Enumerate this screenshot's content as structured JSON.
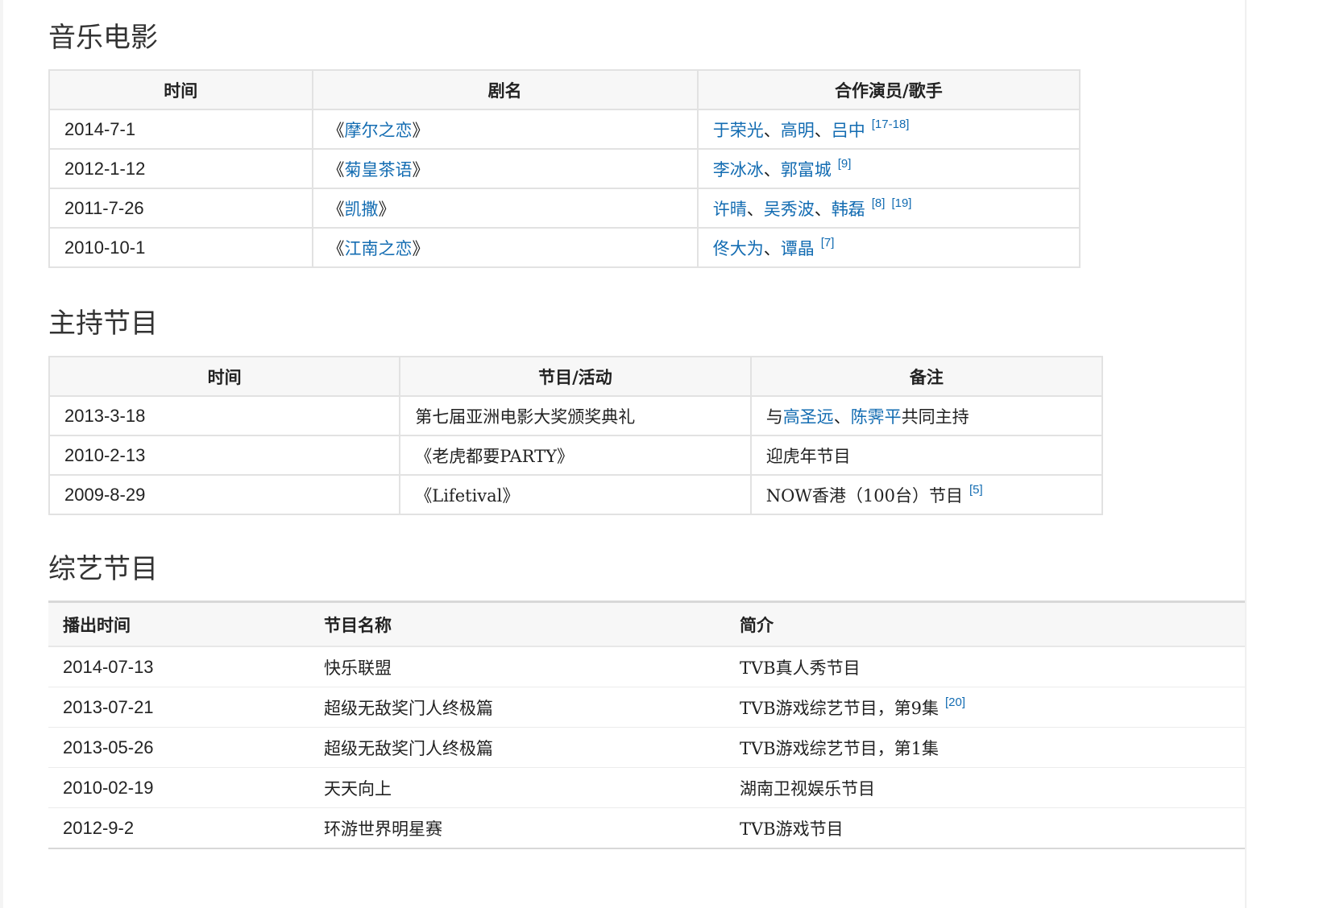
{
  "music_films": {
    "heading": "音乐电影",
    "columns": [
      "时间",
      "剧名",
      "合作演员/歌手"
    ],
    "rows": [
      {
        "date": "2014-7-1",
        "title_open": "《",
        "title": "摩尔之恋",
        "title_close": "》",
        "cast": [
          "于荣光",
          "高明",
          "吕中"
        ],
        "sep": "、",
        "refs": [
          "[17-18]"
        ]
      },
      {
        "date": "2012-1-12",
        "title_open": "《",
        "title": "菊皇茶语",
        "title_close": "》",
        "cast": [
          "李冰冰",
          "郭富城"
        ],
        "sep": "、",
        "refs": [
          "[9]"
        ]
      },
      {
        "date": "2011-7-26",
        "title_open": "《",
        "title": "凯撒",
        "title_close": "》",
        "cast": [
          "许晴",
          "吴秀波",
          "韩磊"
        ],
        "sep": "、",
        "refs": [
          "[8]",
          "[19]"
        ]
      },
      {
        "date": "2010-10-1",
        "title_open": "《",
        "title": "江南之恋",
        "title_close": "》",
        "cast": [
          "佟大为",
          "谭晶"
        ],
        "sep": "、",
        "refs": [
          "[7]"
        ]
      }
    ]
  },
  "hosting": {
    "heading": "主持节目",
    "columns": [
      "时间",
      "节目/活动",
      "备注"
    ],
    "rows": [
      {
        "date": "2013-3-18",
        "program": "第七届亚洲电影大奖颁奖典礼",
        "note_prefix": "与",
        "note_links": [
          "高圣远",
          "陈霁平"
        ],
        "note_sep": "、",
        "note_suffix": "共同主持",
        "refs": []
      },
      {
        "date": "2010-2-13",
        "program": "《老虎都要PARTY》",
        "note_prefix": "迎虎年节目",
        "note_links": [],
        "note_sep": "",
        "note_suffix": "",
        "refs": []
      },
      {
        "date": "2009-8-29",
        "program": "《Lifetival》",
        "note_prefix": "NOW香港（100台）节目",
        "note_links": [],
        "note_sep": "",
        "note_suffix": "",
        "refs": [
          "[5]"
        ]
      }
    ]
  },
  "variety": {
    "heading": "综艺节目",
    "columns": [
      "播出时间",
      "节目名称",
      "简介"
    ],
    "rows": [
      {
        "date": "2014-07-13",
        "name": "快乐联盟",
        "desc": "TVB真人秀节目",
        "refs": []
      },
      {
        "date": "2013-07-21",
        "name": "超级无敌奖门人终极篇",
        "desc": "TVB游戏综艺节目，第9集",
        "refs": [
          "[20]"
        ]
      },
      {
        "date": "2013-05-26",
        "name": "超级无敌奖门人终极篇",
        "desc": "TVB游戏综艺节目，第1集",
        "refs": []
      },
      {
        "date": "2010-02-19",
        "name": "天天向上",
        "desc": "湖南卫视娱乐节目",
        "refs": []
      },
      {
        "date": "2012-9-2",
        "name": "环游世界明星赛",
        "desc": "TVB游戏节目",
        "refs": []
      }
    ]
  },
  "colors": {
    "link": "#136cb2",
    "header_bg": "#f7f7f7",
    "border": "#e2e2e2"
  }
}
